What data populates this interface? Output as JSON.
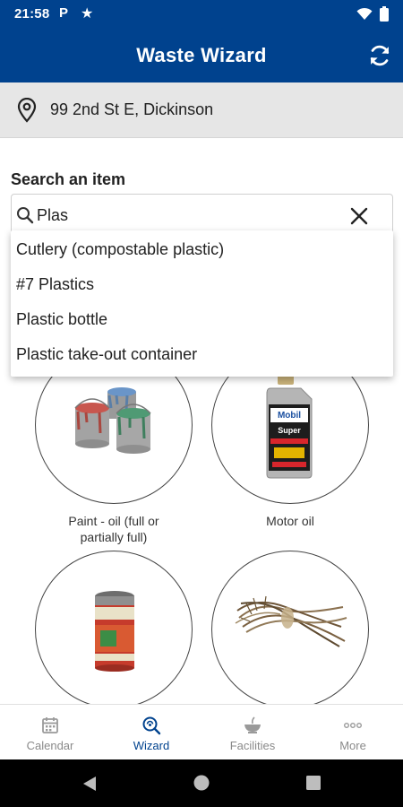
{
  "status_bar": {
    "time": "21:58",
    "app_icon_letter": "P",
    "icons": [
      "parking-icon",
      "star-icon",
      "wifi-icon",
      "battery-icon"
    ]
  },
  "app_bar": {
    "title": "Waste Wizard",
    "refresh_icon": "refresh-icon"
  },
  "location": {
    "icon": "map-pin-icon",
    "address": "99 2nd St E, Dickinson"
  },
  "search": {
    "label": "Search an item",
    "value": "Plas",
    "icon": "search-icon",
    "clear_icon": "close-icon"
  },
  "suggestions": [
    "Cutlery (compostable plastic)",
    "#7 Plastics",
    "Plastic bottle",
    "Plastic take-out container"
  ],
  "items": [
    {
      "name": "Paint - oil (full or partially full)",
      "caption_lines": [
        "Paint - oil (full or",
        "partially full)"
      ],
      "image": "paint-cans"
    },
    {
      "name": "Motor oil",
      "caption_lines": [
        "Motor oil"
      ],
      "image": "motor-oil-bottle"
    },
    {
      "name": "",
      "caption_lines": [],
      "image": "aerosol-can"
    },
    {
      "name": "",
      "caption_lines": [],
      "image": "brush-bundle"
    }
  ],
  "oil_bottle_brand": [
    "Mobil",
    "Super"
  ],
  "bottom_nav": [
    {
      "label": "Calendar",
      "icon": "calendar-icon",
      "active": false
    },
    {
      "label": "Wizard",
      "icon": "wizard-icon",
      "active": true
    },
    {
      "label": "Facilities",
      "icon": "facilities-icon",
      "active": false
    },
    {
      "label": "More",
      "icon": "more-icon",
      "active": false
    }
  ],
  "colors": {
    "primary": "#00428e",
    "address_bar_bg": "#e6e6e6",
    "nav_inactive": "#8a8a8a",
    "nav_active": "#00428e"
  }
}
